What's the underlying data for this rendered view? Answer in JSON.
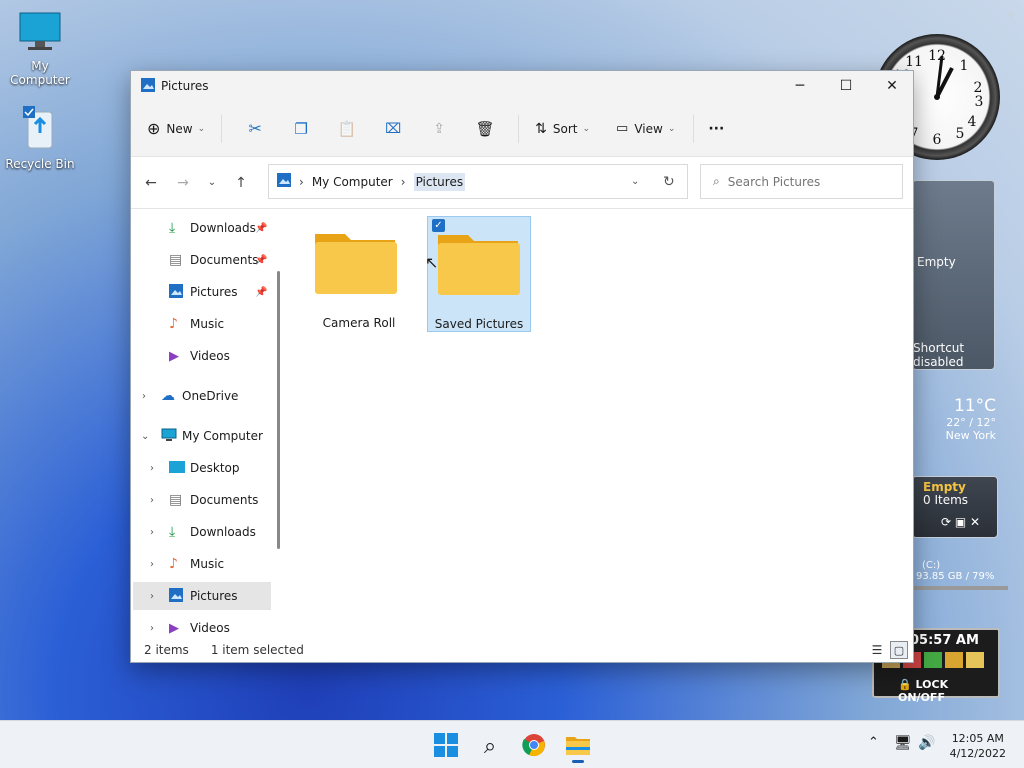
{
  "desktop": {
    "icons": [
      {
        "label": "My Computer",
        "icon": "monitor-icon"
      },
      {
        "label": "Recycle Bin",
        "icon": "recycle-bin-icon"
      }
    ]
  },
  "gadgets": {
    "recycle_panel": {
      "line1": "Empty",
      "line2": "Shortcut",
      "line3": "disabled"
    },
    "weather": {
      "temp": "11°C",
      "range": "22° / 12°",
      "city": "New York"
    },
    "bin": {
      "status": "Empty",
      "count": "0 Items"
    },
    "drive": {
      "label": "(C:)",
      "usage": "93.85 GB / 79%"
    },
    "clock": {
      "time": "05:57 AM",
      "lock": "LOCK ON/OFF"
    }
  },
  "window": {
    "title": "Pictures",
    "toolbar": {
      "new_label": "New",
      "sort_label": "Sort",
      "view_label": "View",
      "more_label": "···"
    },
    "address": {
      "crumbs": [
        "My Computer",
        "Pictures"
      ]
    },
    "search": {
      "placeholder": "Search Pictures"
    },
    "sidebar": {
      "quick": [
        {
          "label": "Downloads",
          "icon": "download-icon",
          "pinned": true
        },
        {
          "label": "Documents",
          "icon": "document-icon",
          "pinned": true
        },
        {
          "label": "Pictures",
          "icon": "pictures-icon",
          "pinned": true
        },
        {
          "label": "Music",
          "icon": "music-icon",
          "pinned": false
        },
        {
          "label": "Videos",
          "icon": "videos-icon",
          "pinned": false
        }
      ],
      "onedrive": "OneDrive",
      "mycomputer": "My Computer",
      "computer_children": [
        {
          "label": "Desktop",
          "icon": "desktop-icon"
        },
        {
          "label": "Documents",
          "icon": "document-icon"
        },
        {
          "label": "Downloads",
          "icon": "download-icon"
        },
        {
          "label": "Music",
          "icon": "music-icon"
        },
        {
          "label": "Pictures",
          "icon": "pictures-icon"
        },
        {
          "label": "Videos",
          "icon": "videos-icon"
        }
      ]
    },
    "folders": [
      {
        "label": "Camera Roll",
        "selected": false
      },
      {
        "label": "Saved Pictures",
        "selected": true
      }
    ],
    "status": {
      "items": "2 items",
      "selection": "1 item selected"
    }
  },
  "taskbar": {
    "apps": [
      "start-icon",
      "search-icon",
      "chrome-icon",
      "file-explorer-icon"
    ],
    "time": "12:05 AM",
    "date": "4/12/2022"
  },
  "colors": {
    "accent": "#1f6fc5",
    "folder": "#f6c443",
    "selection": "#cce4f7"
  }
}
